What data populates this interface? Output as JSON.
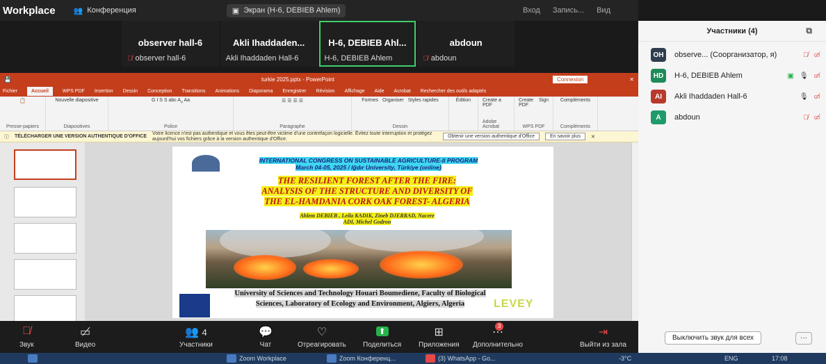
{
  "topbar": {
    "app": "Workplace",
    "conference": "Конференция",
    "screen": "Экран (H-6, DEBIEB Ahlem)",
    "right_items": [
      "Вход",
      "Запись...",
      "Вид"
    ]
  },
  "tiles": [
    {
      "name": "observer hall-6",
      "label": "observer hall-6",
      "muted": true
    },
    {
      "name": "Akli Ihaddaden...",
      "label": "Akli Ihaddaden Hall-6",
      "muted": false
    },
    {
      "name": "H-6, DEBIEB Ahl...",
      "label": "H-6, DEBIEB Ahlem",
      "muted": false,
      "active": true
    },
    {
      "name": "abdoun",
      "label": "abdoun",
      "muted": true
    }
  ],
  "ppt": {
    "file": "turkie 2025.pptx  -  PowerPoint",
    "connexion": "Connexion",
    "tabs": [
      "Fichier",
      "Accueil",
      "WPS PDF",
      "Insertion",
      "Dessin",
      "Conception",
      "Transitions",
      "Animations",
      "Diaporama",
      "Enregistrer",
      "Révision",
      "Affichage",
      "Aide",
      "Acrobat",
      "Rechercher des outils adaptés"
    ],
    "groups": [
      "Presse-papiers",
      "Diapositives",
      "Police",
      "Paragraphe",
      "Dessin",
      "Édition",
      "Adobe Acrobat",
      "WPS PDF",
      "Compléments"
    ],
    "group_buttons": {
      "new_slide": "Nouvelle diapositive",
      "shapes": "Formes",
      "arrange": "Organiser",
      "styles": "Styles rapides",
      "edit": "Édition",
      "create_pdf": "Create a PDF",
      "create_sign": "Create PDF",
      "sign": "Sign",
      "addins": "Compléments"
    },
    "warning": {
      "title": "TÉLÉCHARGER UNE VERSION AUTHENTIQUE D'OFFICE",
      "text": "Votre licence n'est pas authentique et vous êtes peut-être victime d'une contrefaçon logicielle. Évitez toute interruption et protégez aujourd'hui vos fichiers grâce à la version authentique d'Office.",
      "btn1": "Obtenir une version authentique d'Office",
      "btn2": "En savoir plus"
    }
  },
  "slide": {
    "conference": "INTERNATIONAL CONGRESS ON SUSTAINABLE AGRICULTURE-II PROGRAM",
    "dates": "March 04-05, 2025 / Iğdır University, Türkiye (online)",
    "title_lines": [
      "THE RESILIENT FOREST AFTER THE FIRE:",
      "ANALYSIS OF THE STRUCTURE AND DIVERSITY OF",
      "THE EL-HAMDANIA CORK OAK FOREST- ALGERIA"
    ],
    "authors_lines": [
      "Ahlem DEBIEB , Leila KADIK, Zineb DJERRAD, Nacere",
      "ADI, Michel Godron"
    ],
    "univ_lines": [
      "University of Sciences and Technology Houari Boumediene, Faculty of Biological",
      "Sciences, Laboratory of Ecology and Environment, Algiers, Algeria"
    ],
    "logo_text": "LEVEY"
  },
  "toolbar": {
    "mic": "Звук",
    "video": "Видео",
    "participants": "Участники",
    "participants_count": "4",
    "chat": "Чат",
    "react": "Отреагировать",
    "share": "Поделиться",
    "apps": "Приложения",
    "more": "Дополнительно",
    "more_badge": "3",
    "leave": "Выйти из зала"
  },
  "panel": {
    "title": "Участники (4)",
    "participants": [
      {
        "initials": "OH",
        "name": "observe... (Соорганизатор, я)",
        "color": "#2f3d4f"
      },
      {
        "initials": "HD",
        "name": "H-6, DEBIEB Ahlem",
        "color": "#1f8a5a"
      },
      {
        "initials": "AI",
        "name": "Akli Ihaddaden Hall-6",
        "color": "#b83a2e"
      },
      {
        "initials": "A",
        "name": "abdoun",
        "color": "#1f9a6a"
      }
    ],
    "mute_all": "Выключить звук для всех",
    "more": "···"
  },
  "taskbar": {
    "items": [
      "Zoom Workplace",
      "Zoom Конференц...",
      "(3) WhatsApp - Go..."
    ],
    "temp": "-3°C",
    "lang": "ENG",
    "time": "17:08"
  }
}
